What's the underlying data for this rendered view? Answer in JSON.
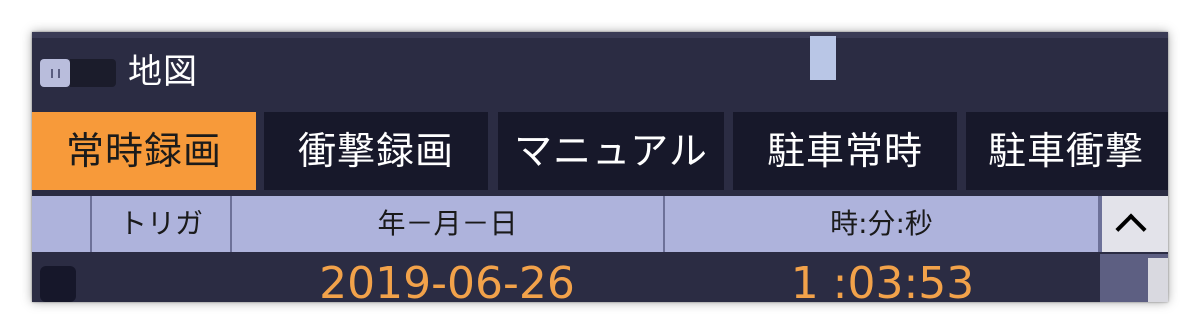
{
  "panel": {
    "title": "地図"
  },
  "tabs": [
    {
      "label": "常時録画",
      "active": true
    },
    {
      "label": "衝撃録画",
      "active": false
    },
    {
      "label": "マニュアル",
      "active": false
    },
    {
      "label": "駐車常時",
      "active": false
    },
    {
      "label": "駐車衝撃",
      "active": false
    }
  ],
  "table": {
    "columns": [
      "",
      "トリガ",
      "年－月－日",
      "時:分:秒"
    ],
    "rows": [
      {
        "trigger": "",
        "date": "2019-06-26",
        "time": "1 :03:53"
      }
    ]
  },
  "colors": {
    "background": "#2b2c43",
    "tab_active": "#f79a3a",
    "tab_inactive": "#17182a",
    "header": "#aeb3dc",
    "row_text": "#f2a24a"
  },
  "icons": {
    "map_toggle": "toggle-switch-icon",
    "sort": "chevron-up-icon"
  }
}
